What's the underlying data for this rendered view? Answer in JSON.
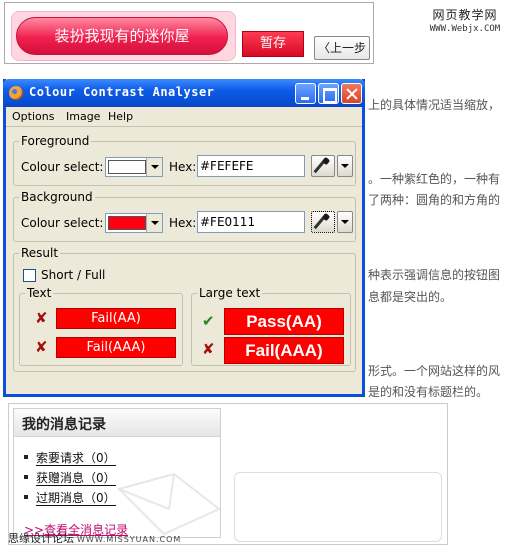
{
  "banner": {
    "dress_button": "装扮我现有的迷你屋",
    "save_button": "暂存",
    "prev_button": "〈上一步"
  },
  "site": {
    "name_cn": "网页教学网",
    "url": "WWW.Webjx.COM"
  },
  "background_text": [
    "上的具体情况适当缩放，",
    "。一种紫红色的，一种有",
    "了两种：圆角的和方角的",
    "种表示强调信息的按钮图",
    "息都是突出的。",
    "形式。一个网站这样的风",
    "是的和没有标题栏的。"
  ],
  "window": {
    "title": "Colour Contrast Analyser",
    "menu": [
      "Options",
      "Image",
      "Help"
    ],
    "foreground": {
      "legend": "Foreground",
      "colour_select_label": "Colour select:",
      "hex_label": "Hex:",
      "hex_value": "#FEFEFE",
      "swatch_color": "#FEFEFE"
    },
    "background": {
      "legend": "Background",
      "colour_select_label": "Colour select:",
      "hex_label": "Hex:",
      "hex_value": "#FE0111",
      "swatch_color": "#FE0111"
    },
    "result": {
      "legend": "Result",
      "checkbox_label": "Short / Full",
      "checkbox_checked": false,
      "text_group": {
        "legend": "Text",
        "rows": [
          {
            "status": "fail",
            "label": "Fail(AA)"
          },
          {
            "status": "fail",
            "label": "Fail(AAA)"
          }
        ]
      },
      "large_group": {
        "legend": "Large text",
        "rows": [
          {
            "status": "pass",
            "label": "Pass(AA)"
          },
          {
            "status": "fail",
            "label": "Fail(AAA)"
          }
        ]
      }
    }
  },
  "messages": {
    "title": "我的消息记录",
    "items": [
      "索要请求（0）",
      "获赠消息（0）",
      "过期消息（0）"
    ],
    "view_all": ">>查看全消息记录"
  },
  "footer": {
    "text": "思缘设计论坛",
    "url": "WWW.MISSYUAN.COM"
  },
  "colors": {
    "fail_mark": "#a41010",
    "pass_mark": "#1f8a1f",
    "result_bg": "#ff0000",
    "titlebar": "#0a4fd5"
  }
}
